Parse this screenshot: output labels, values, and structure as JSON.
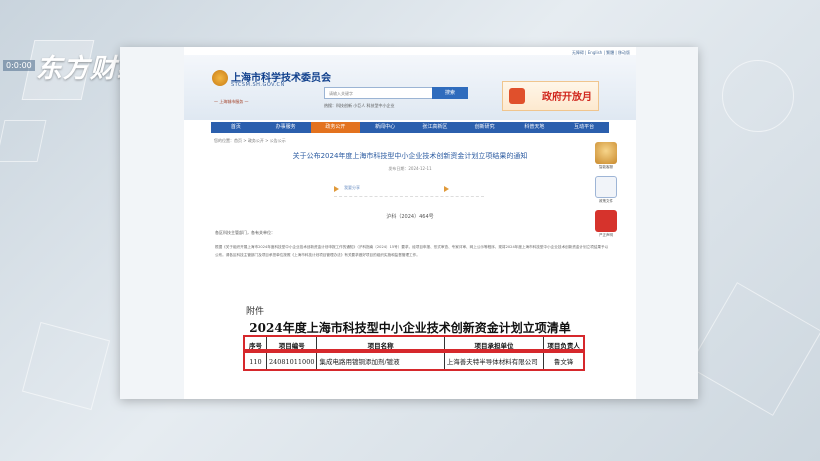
{
  "overlay": {
    "logo_text": "东方财经",
    "logo_badge": "0:0:00"
  },
  "site": {
    "title": "上海市科学技术委员会",
    "url": "STCSM.SH.GOV.CN",
    "top_links": "无障碍 | English | 繁體 | 移动版",
    "mini_links": "— 上海城市服务 —",
    "search_placeholder": "请输入关键字",
    "search_button": "搜索",
    "hot_words": "热搜：科技创新  小巨人  科技型中小企业",
    "open_banner": "政府开放月"
  },
  "nav": {
    "items": [
      {
        "label": "首页",
        "active": false
      },
      {
        "label": "办事服务",
        "active": false
      },
      {
        "label": "政务公开",
        "active": true
      },
      {
        "label": "新闻中心",
        "active": false
      },
      {
        "label": "张江高新区",
        "active": false
      },
      {
        "label": "创新研究",
        "active": false
      },
      {
        "label": "科普天地",
        "active": false
      },
      {
        "label": "互动平台",
        "active": false
      }
    ]
  },
  "article": {
    "breadcrumb": "您的位置：首页 > 政务公开 > 公告公示",
    "title": "关于公布2024年度上海市科技型中小企业技术创新资金计划立项结果的通知",
    "date": "发布日期：2024-12-11",
    "share_label": "我要分享",
    "doc_number": "沪科（2024）464号",
    "salutation": "各区科技主管部门，各有关单位：",
    "body": "根据《关于组织开展上海市2024年度科技型中小企业技术创新资金计划申报工作的通知》（沪科指南〔2024〕15号）要求，经项目申报、形式审查、专家评审、网上公示等程序，现将2024年度上海市科技型中小企业技术创新资金计划立项结果予以公布。请各区科技主管部门及项目承担单位按照《上海市科技计划项目管理办法》有关要求做好项目的组织实施和监督管理工作。"
  },
  "attachment": {
    "label": "附件",
    "table_title": "2024年度上海市科技型中小企业技术创新资金计划立项清单",
    "columns": [
      "序号",
      "项目编号",
      "项目名称",
      "项目承担单位",
      "项目负责人"
    ],
    "rows": [
      [
        "110",
        "24081011000",
        "集成电路用镀铜添加剂/镀液",
        "上海善夫特半导体材料有限公司",
        "鲁文锋"
      ]
    ]
  },
  "side_tools": [
    {
      "label": "智能客服"
    },
    {
      "label": "政策文件"
    },
    {
      "label": "严正声明"
    }
  ]
}
